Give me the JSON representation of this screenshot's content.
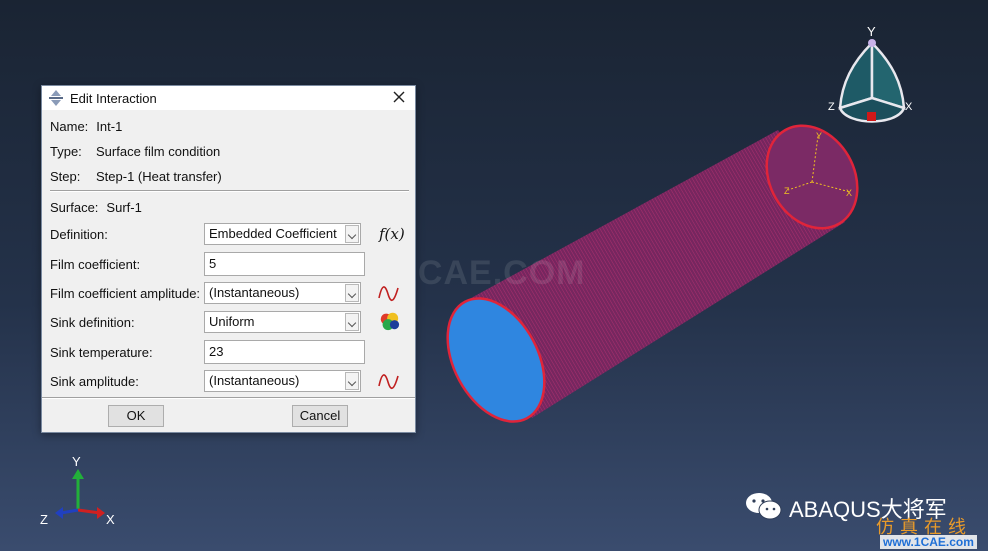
{
  "viewport": {
    "watermark": "1CAE.COM",
    "triad_bottom": {
      "y": "Y",
      "x": "X",
      "z": "Z"
    },
    "triad_top": {
      "y": "Y",
      "x": "X",
      "z": "Z"
    },
    "logo_text": "ABAQUS大将军",
    "site_cn": "仿真在线",
    "site_url": "www.1CAE.com"
  },
  "dialog": {
    "title": "Edit Interaction",
    "name_label": "Name:",
    "name_value": "Int-1",
    "type_label": "Type:",
    "type_value": "Surface film condition",
    "step_label": "Step:",
    "step_value": "Step-1 (Heat transfer)",
    "surface_label": "Surface:",
    "surface_value": "Surf-1",
    "definition_label": "Definition:",
    "definition_value": "Embedded Coefficient",
    "film_coef_label": "Film coefficient:",
    "film_coef_value": "5",
    "film_amp_label": "Film coefficient amplitude:",
    "film_amp_value": "(Instantaneous)",
    "sink_def_label": "Sink definition:",
    "sink_def_value": "Uniform",
    "sink_temp_label": "Sink temperature:",
    "sink_temp_value": "23",
    "sink_amp_label": "Sink amplitude:",
    "sink_amp_value": "(Instantaneous)",
    "fx_label": "f(x)",
    "ok_label": "OK",
    "cancel_label": "Cancel"
  },
  "colors": {
    "cylinder_body": "#8a2a6a",
    "cylinder_edge": "#e0243a",
    "end_face": "#2f86e0"
  }
}
